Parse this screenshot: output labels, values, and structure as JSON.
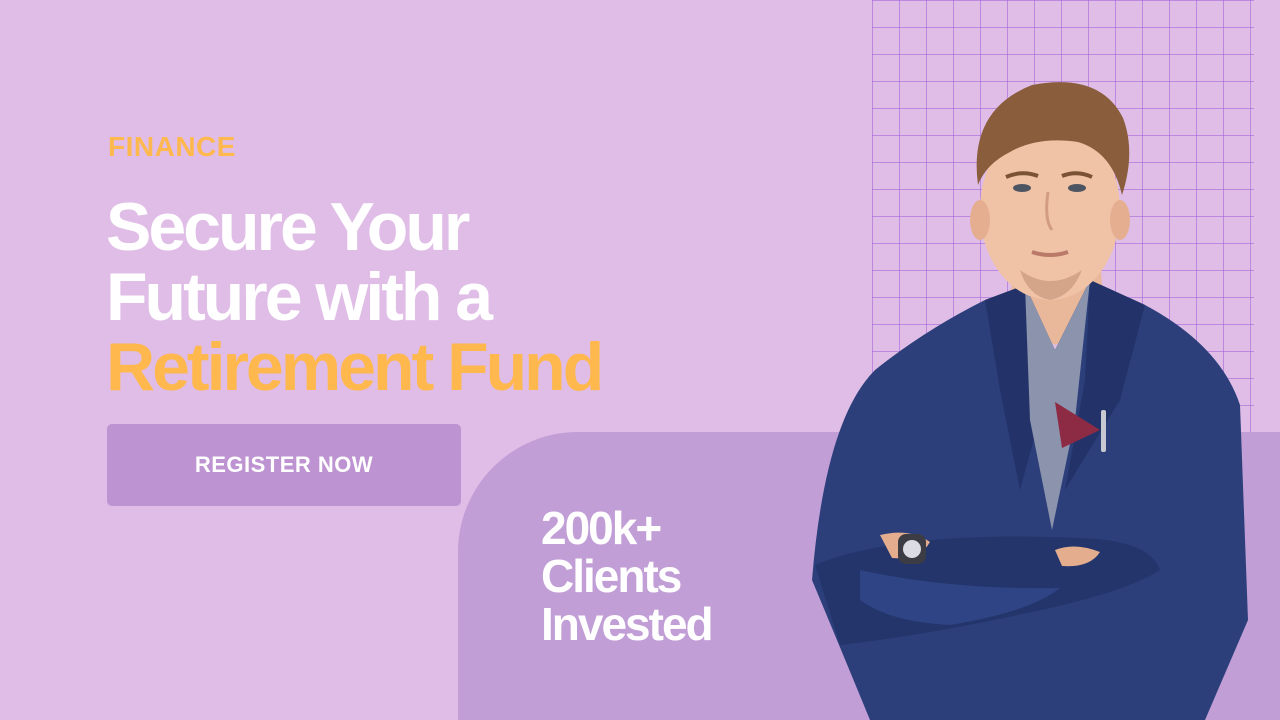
{
  "banner": {
    "category": "FINANCE",
    "headline": {
      "line1": "Secure Your",
      "line2": "Future with a",
      "line3_highlight": "Retirement Fund"
    },
    "cta_label": "REGISTER NOW",
    "stat": {
      "line1": "200k+",
      "line2": "Clients",
      "line3": "Invested"
    }
  },
  "colors": {
    "background": "#dfbde6",
    "panel": "#c19ed6",
    "accent": "#ffb84d",
    "button": "#bd93d2",
    "text": "#ffffff",
    "suit": "#2c3f7a"
  }
}
